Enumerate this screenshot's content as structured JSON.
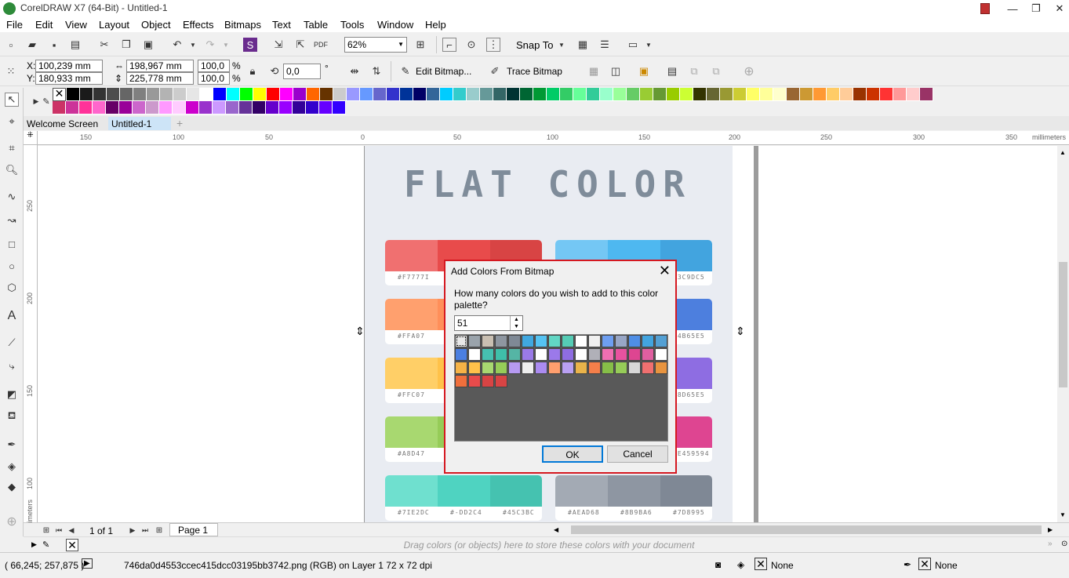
{
  "window": {
    "title": "CorelDRAW X7 (64-Bit) - Untitled-1"
  },
  "menu": [
    "File",
    "Edit",
    "View",
    "Layout",
    "Object",
    "Effects",
    "Bitmaps",
    "Text",
    "Table",
    "Tools",
    "Window",
    "Help"
  ],
  "standard_toolbar": {
    "zoom": "62%",
    "snap_to": "Snap To"
  },
  "property_bar": {
    "x": "100,239 mm",
    "y": "180,933 mm",
    "width": "198,967 mm",
    "height": "225,778 mm",
    "scale_x": "100,0",
    "scale_y": "100,0",
    "percent": "%",
    "rotation": "0,0",
    "degree": "°",
    "edit_bitmap": "Edit Bitmap...",
    "trace_bitmap": "Trace Bitmap"
  },
  "palette_colors": [
    "#000000",
    "#1a1a1a",
    "#333333",
    "#4d4d4d",
    "#666666",
    "#808080",
    "#999999",
    "#b3b3b3",
    "#cccccc",
    "#e6e6e6",
    "#ffffff",
    "#0000ff",
    "#00ffff",
    "#00ff00",
    "#ffff00",
    "#ff0000",
    "#ff00ff",
    "#9900cc",
    "#ff6600",
    "#663300",
    "#cccccc",
    "#9999ff",
    "#6699ff",
    "#6666cc",
    "#3333cc",
    "#003399",
    "#000066",
    "#336699",
    "#00ccff",
    "#33cccc",
    "#99cccc",
    "#669999",
    "#336666",
    "#003333",
    "#006633",
    "#009933",
    "#00cc66",
    "#33cc66",
    "#66ff99",
    "#33cc99",
    "#99ffcc",
    "#99ff99",
    "#66cc66",
    "#99cc33",
    "#669933",
    "#99cc00",
    "#ccff33",
    "#333300",
    "#666633",
    "#999933",
    "#cccc33",
    "#ffff66",
    "#ffff99",
    "#ffffcc",
    "#996633",
    "#cc9933",
    "#ff9933",
    "#ffcc66",
    "#ffcc99",
    "#993300",
    "#cc3300",
    "#ff3333",
    "#ff9999",
    "#ffcccc",
    "#993366"
  ],
  "palette_colors_row2": [
    "#cc3366",
    "#cc3399",
    "#ff3399",
    "#ff66cc",
    "#660066",
    "#990099",
    "#cc66cc",
    "#cc99cc",
    "#ff99ff",
    "#ffccff",
    "#cc00cc",
    "#9933cc",
    "#cc99ff",
    "#9966cc",
    "#663399",
    "#330066",
    "#6600cc",
    "#9900ff",
    "#330099",
    "#3300cc",
    "#6600ff",
    "#3300ff"
  ],
  "tabs": {
    "welcome": "Welcome Screen",
    "doc": "Untitled-1",
    "add": "+"
  },
  "hruler_ticks": [
    "150",
    "100",
    "50",
    "0",
    "50",
    "100",
    "150",
    "200",
    "250",
    "300",
    "350",
    "millimeters"
  ],
  "vruler_ticks": [
    "250",
    "200",
    "150",
    "100",
    "millimeters"
  ],
  "canvas": {
    "title": "FLAT COLOR",
    "cards": [
      {
        "colors": [
          "#f07070",
          "#e84b4b",
          "#d84444"
        ],
        "codes": [
          "#F7777I",
          "",
          ""
        ]
      },
      {
        "colors": [
          "#74c7f4",
          "#4eb8f0",
          "#42a4df"
        ],
        "codes": [
          "",
          "",
          "#3C9DC5"
        ]
      },
      {
        "colors": [
          "#ffa06e",
          "#ff8f5a",
          "#f47f4a"
        ],
        "codes": [
          "#FFA07",
          "",
          ""
        ]
      },
      {
        "colors": [
          "#6d9df0",
          "#5a8ee6",
          "#4d7fde"
        ],
        "codes": [
          "",
          "",
          "#4B65E5"
        ]
      },
      {
        "colors": [
          "#ffcf67",
          "#ffc24a",
          "#f5b53a"
        ],
        "codes": [
          "#FFC07",
          "",
          ""
        ]
      },
      {
        "colors": [
          "#a98bf0",
          "#9a79ea",
          "#8e6de2"
        ],
        "codes": [
          "",
          "",
          "#8D65E5"
        ]
      },
      {
        "colors": [
          "#a8d870",
          "#96cc58",
          "#86be48"
        ],
        "codes": [
          "#A8D47",
          "",
          ""
        ]
      },
      {
        "colors": [
          "#ef69b0",
          "#e8529f",
          "#de4591"
        ],
        "codes": [
          "",
          "",
          "#E459594"
        ]
      },
      {
        "colors": [
          "#6fe0cf",
          "#4fd3c1",
          "#45c2b0"
        ],
        "codes": [
          "#7IE2DC",
          "#-DD2C4",
          "#45C3BC"
        ]
      },
      {
        "colors": [
          "#a3aab4",
          "#8e96a2",
          "#7f8895"
        ],
        "codes": [
          "#AEAD68",
          "#8B9BA6",
          "#7D8995"
        ]
      }
    ]
  },
  "page_nav": {
    "page_of": "1 of 1",
    "page_tab": "Page 1"
  },
  "doc_palette_hint": "Drag colors (or objects) here to store these colors with your document",
  "status": {
    "coords": "( 66,245; 257,875 )",
    "info": "746da0d4553ccec415dcc03195bb3742.png (RGB) on Layer 1 72 x 72 dpi",
    "fill": "None",
    "outline": "None"
  },
  "dialog": {
    "title": "Add Colors From Bitmap",
    "prompt": "How many colors do you wish to add to this color palette?",
    "count": "51",
    "ok": "OK",
    "cancel": "Cancel",
    "grid_colors": [
      "#e8e8e8",
      "#9aa3ab",
      "#c9bfb2",
      "#8e96a0",
      "#7f8995",
      "#40a8e0",
      "#55c3f2",
      "#62d6c4",
      "#55ccb5",
      "#ffffff",
      "#f0f0f0",
      "#6e9ef0",
      "#98a6c6",
      "#4f8ee6",
      "#42a4df",
      "#53a0d4",
      "#4b7fe0",
      "#ffffff",
      "#46c0b0",
      "#3fbfa9",
      "#55b5a5",
      "#9a7ae8",
      "#ffffff",
      "#9b79ea",
      "#8e6de2",
      "#ffffff",
      "#b0b0b8",
      "#ef6fb2",
      "#e8529f",
      "#de4591",
      "#e05fa0",
      "#ffffff",
      "#f6b346",
      "#ffc24a",
      "#a8d870",
      "#96cc58",
      "#b79af2",
      "#eeeeee",
      "#ab8bf0",
      "#ff9f6e",
      "#b9a0f2",
      "#eab34a",
      "#f47f4a",
      "#86be48",
      "#96cc58",
      "#d8d8d8",
      "#f07070",
      "#e8943f",
      "#ef6f3c",
      "#e84b4b",
      "#d84444",
      "#d84444"
    ]
  }
}
